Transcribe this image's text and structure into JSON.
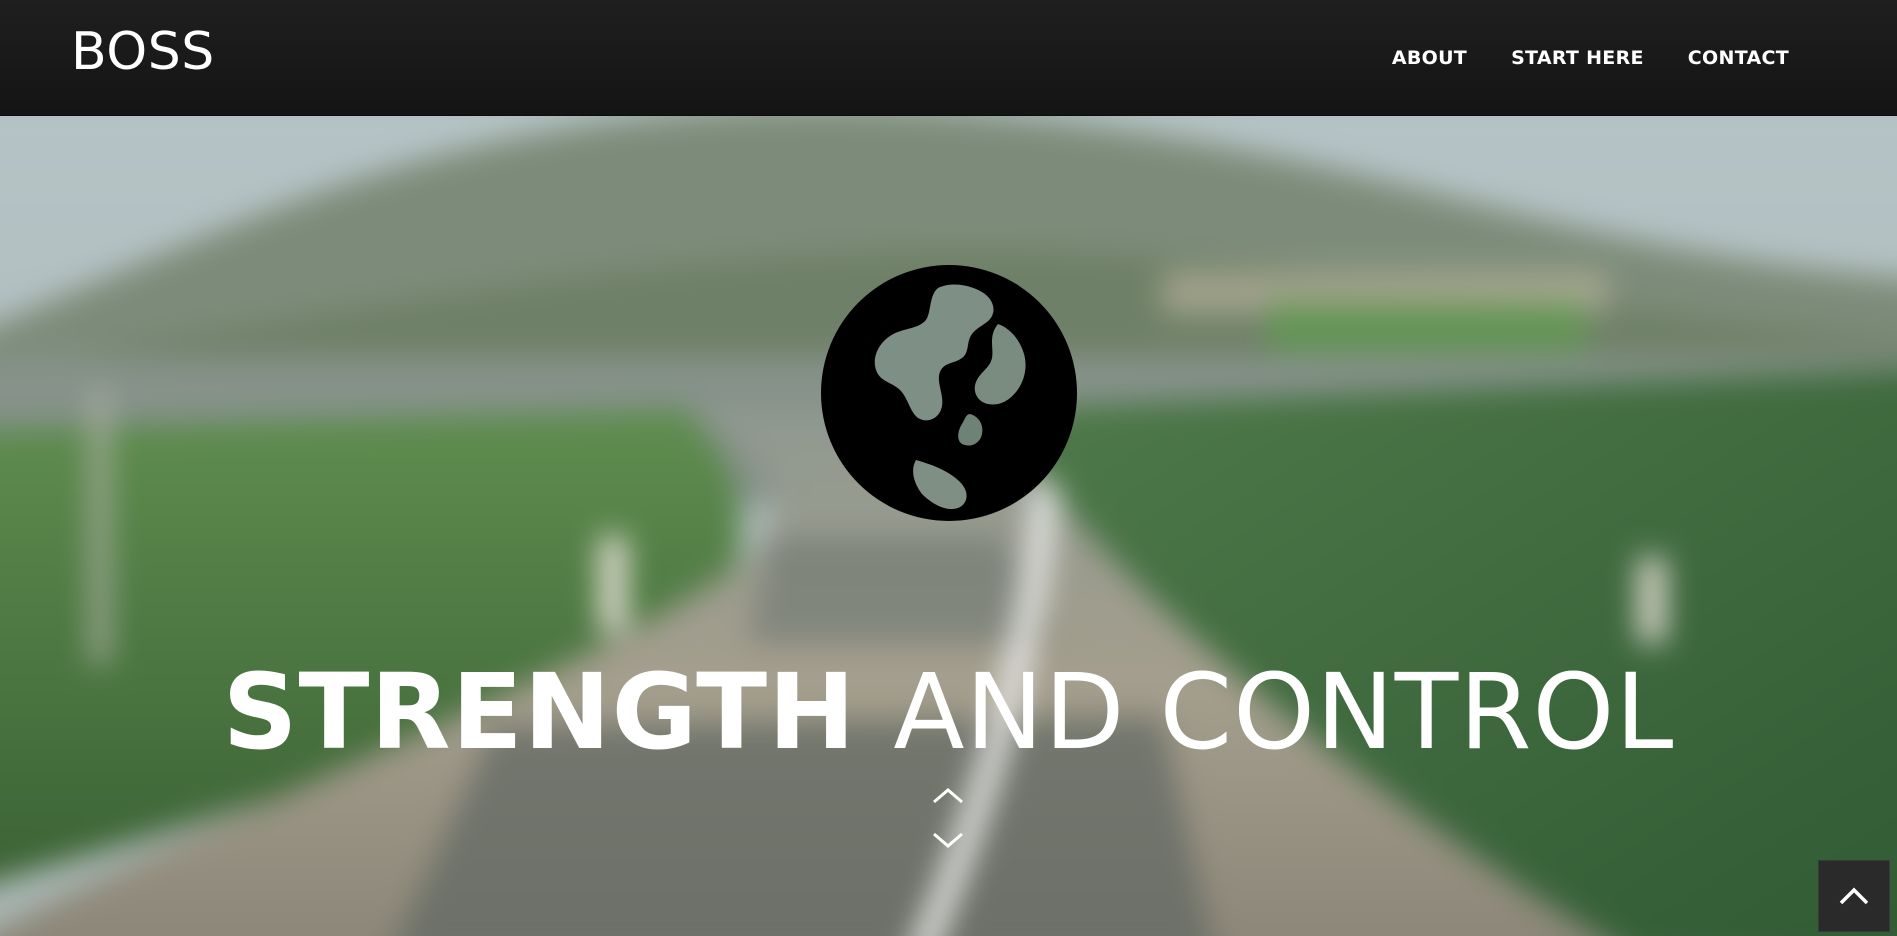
{
  "header": {
    "brand": "BOSS",
    "nav": [
      {
        "label": "ABOUT"
      },
      {
        "label": "START HERE"
      },
      {
        "label": "CONTACT"
      }
    ]
  },
  "hero": {
    "headline_strong": "STRENGTH",
    "headline_light": "AND CONTROL",
    "icon": "globe-icon",
    "scroll_icon": "scroll-arrows-icon"
  },
  "back_to_top": {
    "icon": "chevron-up-icon"
  },
  "colors": {
    "navbar": "#181818",
    "text": "#ffffff",
    "to_top_bg": "#2a2a2a"
  }
}
